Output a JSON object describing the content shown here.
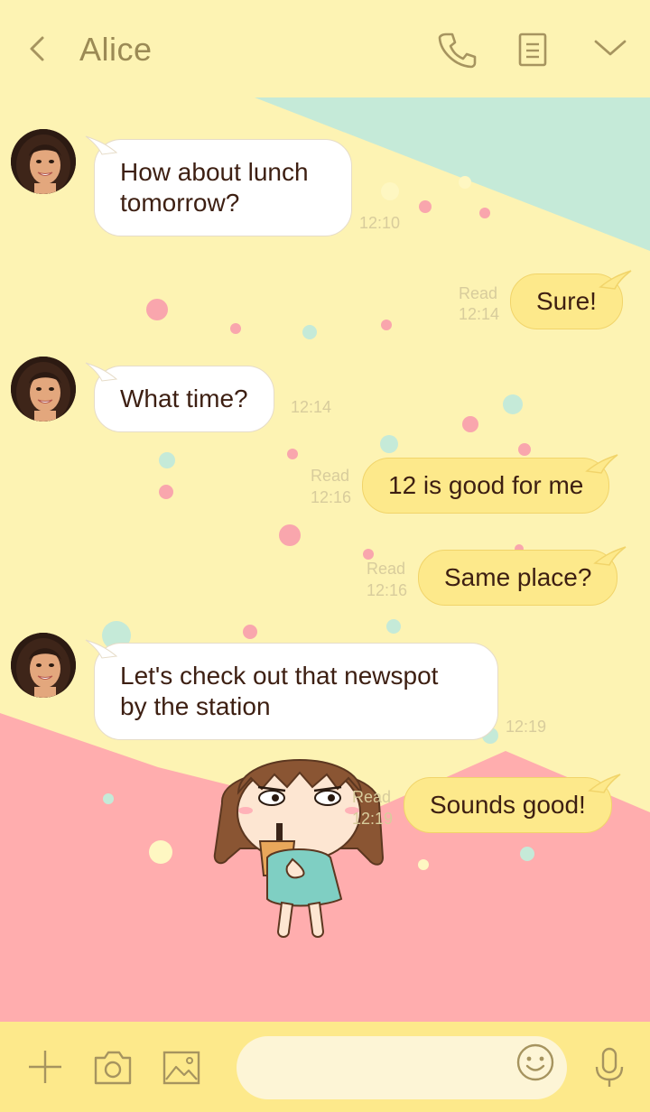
{
  "header": {
    "title": "Alice",
    "icons": [
      "back-chevron-icon",
      "phone-icon",
      "notes-icon",
      "chevron-down-icon"
    ]
  },
  "messages": [
    {
      "side": "in",
      "text": "How about lunch\ntomorrow?",
      "time": "12:10"
    },
    {
      "side": "out",
      "text": "Sure!",
      "status": "Read",
      "time": "12:14"
    },
    {
      "side": "in",
      "text": "What time?",
      "time": "12:14"
    },
    {
      "side": "out",
      "text": "12 is good for me",
      "status": "Read",
      "time": "12:16"
    },
    {
      "side": "out",
      "text": "Same place?",
      "status": "Read",
      "time": "12:16"
    },
    {
      "side": "in",
      "text": "Let's check out that newspot\nby the station",
      "time": "12:19"
    },
    {
      "side": "out",
      "text": "Sounds good!",
      "status": "Read",
      "time": "12:19"
    }
  ],
  "footer": {
    "icons": [
      "plus-icon",
      "camera-icon",
      "image-icon",
      "emoji-icon",
      "microphone-icon"
    ],
    "input_value": "",
    "input_placeholder": ""
  },
  "theme": {
    "background": "#fdf3b3",
    "accent_pink": "#ffadae",
    "accent_mint": "#c5ead8",
    "bubble_out": "#fde98b",
    "bubble_in": "#ffffff",
    "text": "#3d1f12",
    "header_text": "#9b8a55",
    "time_text": "#d8cc9c"
  }
}
